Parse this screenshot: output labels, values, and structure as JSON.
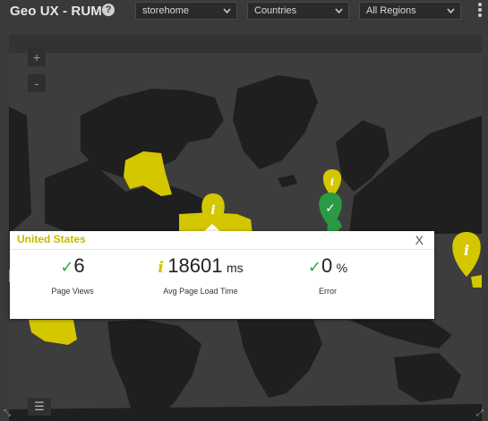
{
  "header": {
    "title": "Geo UX - RUM",
    "help_icon": "?",
    "selects": [
      {
        "value": "storehome"
      },
      {
        "value": "Countries"
      },
      {
        "value": "All Regions"
      }
    ],
    "chevron": "⌄"
  },
  "map": {
    "zoom_in": "+",
    "zoom_out": "-",
    "colors": {
      "land": "#1f1f1f",
      "water": "#3d3d3d",
      "warning": "#d4c700",
      "ok": "#2b9a44"
    },
    "markers": [
      {
        "status": "warning",
        "icon": "i"
      },
      {
        "status": "warning",
        "icon": "i"
      },
      {
        "status": "ok",
        "icon": "✓"
      },
      {
        "status": "warning",
        "icon": "i"
      }
    ]
  },
  "popup": {
    "title": "United States",
    "close": "X",
    "metrics": [
      {
        "icon": "✓",
        "value": "6",
        "unit": "",
        "label": "Page Views"
      },
      {
        "icon": "i",
        "value": "18601",
        "unit": "ms",
        "label": "Avg Page Load Time"
      },
      {
        "icon": "✓",
        "value": "0",
        "unit": "%",
        "label": "Error"
      }
    ]
  },
  "footer": {
    "menu_icon": "☰",
    "corner_left": "⤡",
    "corner_right": "⤢"
  }
}
